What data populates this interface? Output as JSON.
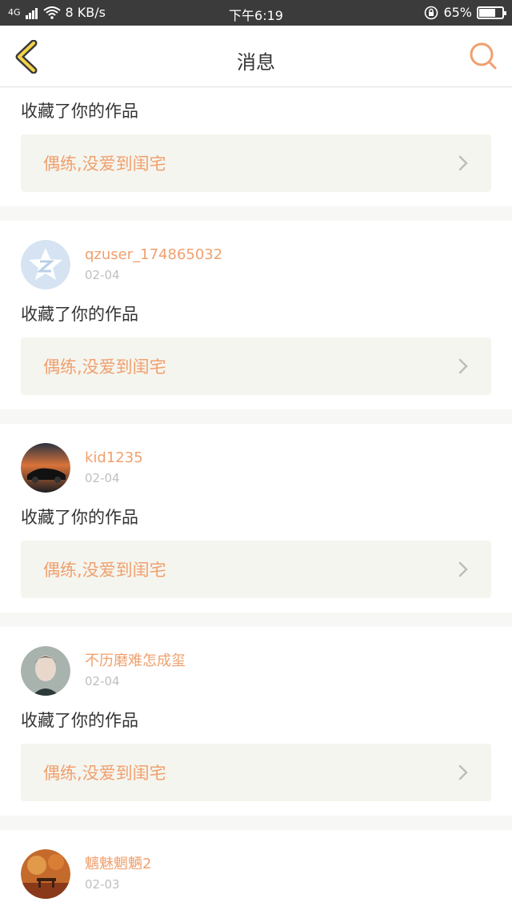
{
  "status_bar": {
    "network": "4G",
    "speed": "8 KB/s",
    "time": "下午6:19",
    "battery": "65%"
  },
  "header": {
    "title": "消息",
    "back_icon": "chevron-left-icon",
    "search_icon": "search-icon"
  },
  "colors": {
    "accent": "#f0a06e",
    "work_bg": "#f5f5ef"
  },
  "messages": [
    {
      "action": "收藏了你的作品",
      "work_title": "偶练,没爱到闺宅"
    },
    {
      "user": "qzuser_174865032",
      "date": "02-04",
      "action": "收藏了你的作品",
      "work_title": "偶练,没爱到闺宅",
      "avatar": "qq-default-avatar"
    },
    {
      "user": "kid1235",
      "date": "02-04",
      "action": "收藏了你的作品",
      "work_title": "偶练,没爱到闺宅",
      "avatar": "car-sunset-avatar"
    },
    {
      "user": "不历磨难怎成玺",
      "date": "02-04",
      "action": "收藏了你的作品",
      "work_title": "偶练,没爱到闺宅",
      "avatar": "portrait-avatar"
    },
    {
      "user": "魑魅魍魉2",
      "date": "02-03",
      "avatar": "autumn-bench-avatar"
    }
  ]
}
